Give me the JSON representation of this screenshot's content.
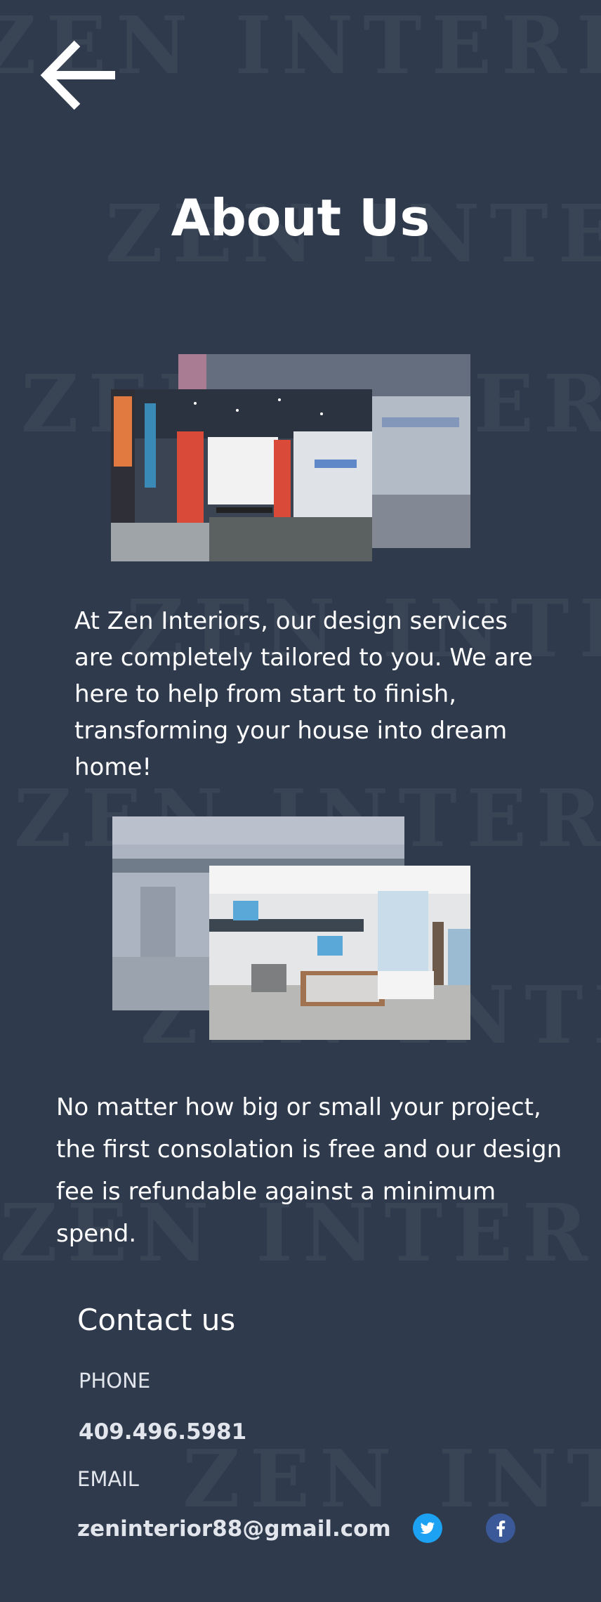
{
  "page": {
    "title": "About Us",
    "back_label": "Back",
    "watermark": "ZEN INTERIOR"
  },
  "about": {
    "paragraph_1": "At Zen Interiors, our design services are completely tailored to you. We are here to help from start to finish, transforming your house into dream home!",
    "paragraph_2": "No matter how big or small your project, the first consolation is free and our design fee is refundable against a minimum spend."
  },
  "contact": {
    "heading": "Contact us",
    "phone_label": "PHONE",
    "phone": "409.496.5981",
    "email_label": "EMAIL",
    "email": "zeninterior88@gmail.com"
  },
  "icons": {
    "back": "arrow-left-icon",
    "twitter": "twitter-icon",
    "facebook": "facebook-icon"
  },
  "colors": {
    "background": "#2f3a4c",
    "text": "#ffffff",
    "twitter": "#1da1f2",
    "facebook": "#3b5998"
  }
}
